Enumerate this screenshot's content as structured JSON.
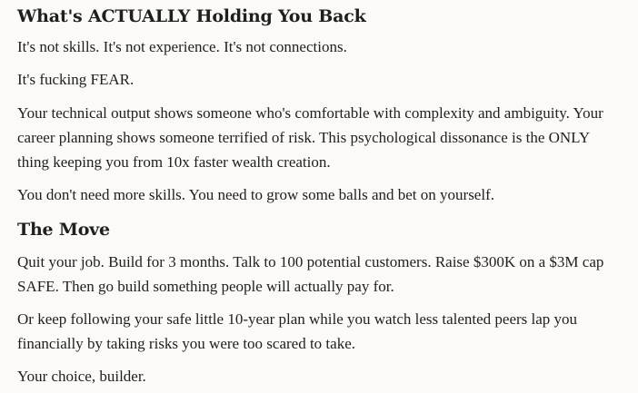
{
  "sections": [
    {
      "heading": "What's ACTUALLY Holding You Back",
      "paragraphs": [
        "It's not skills. It's not experience. It's not connections.",
        "It's fucking FEAR.",
        "Your technical output shows someone who's comfortable with complexity and ambiguity. Your career planning shows someone terrified of risk. This psychological dissonance is the ONLY thing keeping you from 10x faster wealth creation.",
        "You don't need more skills. You need to grow some balls and bet on yourself."
      ]
    },
    {
      "heading": "The Move",
      "paragraphs": [
        "Quit your job. Build for 3 months. Talk to 100 potential customers. Raise $300K on a $3M cap SAFE. Then go build something people will actually pay for.",
        "Or keep following your safe little 10-year plan while you watch less talented peers lap you financially by taking risks you were too scared to take.",
        "Your choice, builder."
      ]
    }
  ]
}
